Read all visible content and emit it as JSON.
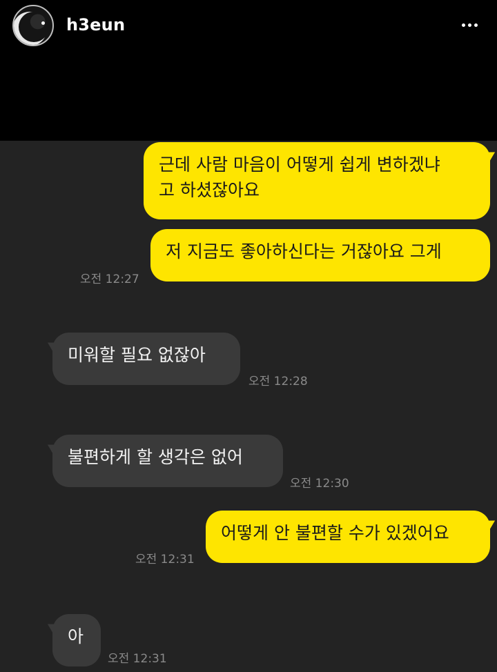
{
  "header": {
    "username": "h3eun",
    "avatar_icon": "avatar",
    "more_icon": "more-horizontal-icon"
  },
  "messages": [
    {
      "direction": "outgoing",
      "text": "근데 사람 마음이 어떻게 쉽게 변하겠냐\n고 하셨잖아요",
      "time": ""
    },
    {
      "direction": "outgoing",
      "text": "저 지금도 좋아하신다는 거잖아요 그게",
      "time": "오전 12:27"
    },
    {
      "direction": "incoming",
      "text": "미워할 필요 없잖아",
      "time": "오전 12:28"
    },
    {
      "direction": "incoming",
      "text": "불편하게 할 생각은 없어",
      "time": "오전 12:30"
    },
    {
      "direction": "outgoing",
      "text": "어떻게 안 불편할 수가 있겠어요",
      "time": "오전 12:31"
    },
    {
      "direction": "incoming",
      "text": "아",
      "time": "오전 12:31"
    }
  ],
  "colors": {
    "outgoing_bubble": "#fee500",
    "incoming_bubble": "#3a3a3a",
    "chat_background": "#232323"
  }
}
